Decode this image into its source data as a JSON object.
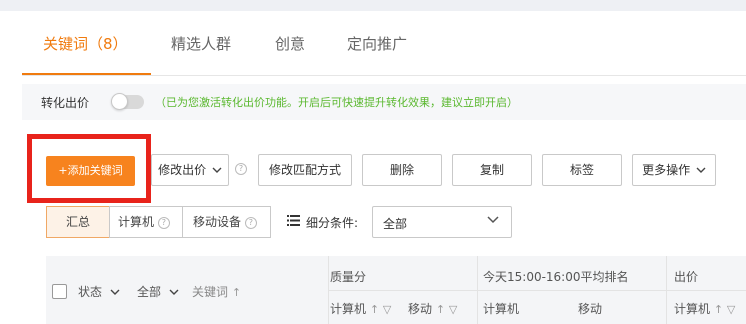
{
  "tabs": [
    {
      "label": "关键词（8）"
    },
    {
      "label": "精选人群"
    },
    {
      "label": "创意"
    },
    {
      "label": "定向推广"
    }
  ],
  "notice": {
    "label": "转化出价",
    "text": "（已为您激活转化出价功能。开启后可快速提升转化效果，建议立即开启）"
  },
  "toolbar": {
    "add_keyword": "+添加关键词",
    "modify_bid": "修改出价",
    "modify_match": "修改匹配方式",
    "delete": "删除",
    "copy": "复制",
    "tag": "标签",
    "more": "更多操作"
  },
  "segments": {
    "summary": "汇总",
    "computer": "计算机",
    "mobile": "移动设备"
  },
  "filter": {
    "label": "细分条件:",
    "value": "全部"
  },
  "table": {
    "status": "状态",
    "all": "全部",
    "keyword": "关键词",
    "quality_score": "质量分",
    "rank_header": "今天15:00-16:00平均排名",
    "bid": "出价",
    "computer": "计算机",
    "mobile": "移动"
  },
  "colors": {
    "accent": "#f07b0f",
    "primary_button": "#f7831e",
    "highlight_box": "#e8231b",
    "notice_text": "#5ab82f"
  }
}
